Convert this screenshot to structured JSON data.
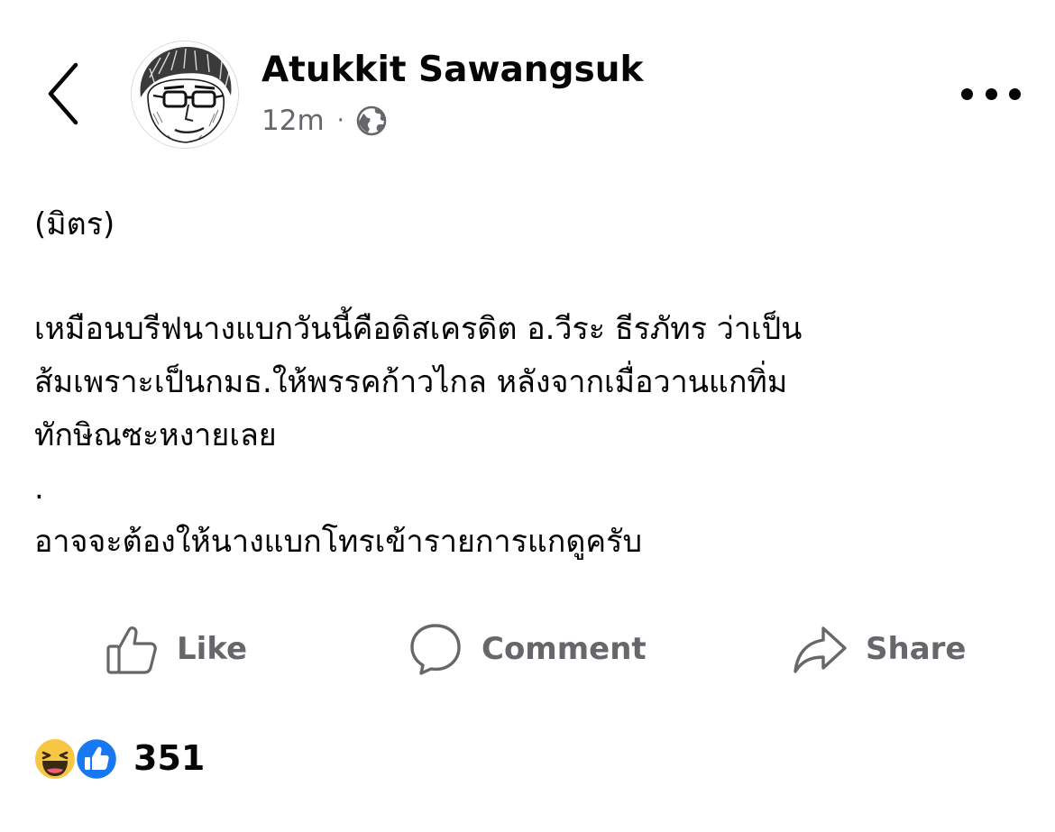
{
  "header": {
    "author_name": "Atukkit Sawangsuk",
    "timestamp": "12m",
    "separator": "·",
    "audience_icon": "globe-icon",
    "back_icon": "chevron-left-icon",
    "more_icon": "more-horizontal-icon"
  },
  "post": {
    "lines": [
      "(มิตร)",
      "",
      "เหมือนบรีฟนางแบกวันนี้คือดิสเครดิต อ.วีระ ธีรภัทร ว่าเป็น",
      "ส้มเพราะเป็นกมธ.ให้พรรคก้าวไกล หลังจากเมื่อวานแกทิ่ม",
      "ทักษิณซะหงายเลย",
      ".",
      "อาจจะต้องให้นางแบกโทรเข้ารายการแกดูครับ"
    ]
  },
  "actions": {
    "like_label": "Like",
    "comment_label": "Comment",
    "share_label": "Share"
  },
  "reactions": {
    "icons": [
      "haha-reaction-icon",
      "like-reaction-icon"
    ],
    "count": "351"
  },
  "colors": {
    "text_primary": "#050505",
    "text_secondary": "#65676b",
    "like_blue": "#1877f2",
    "haha_yellow": "#f7c642"
  }
}
